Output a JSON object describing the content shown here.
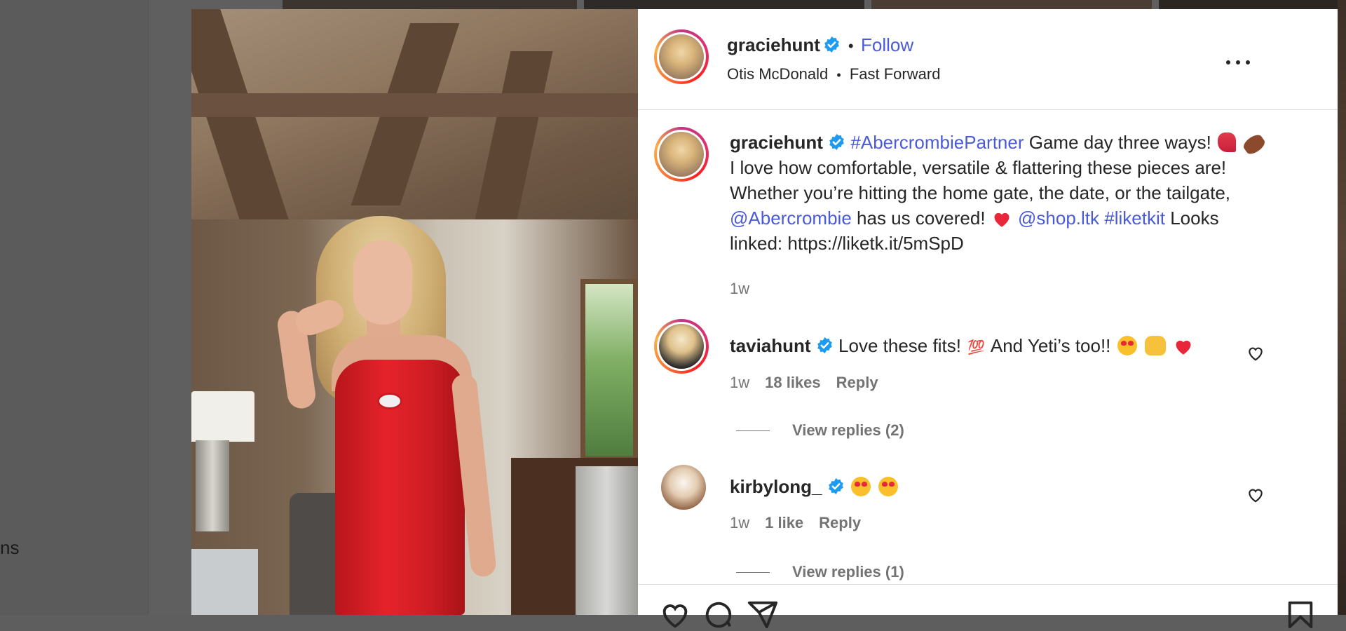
{
  "background": {
    "sidebar_fragment": "ns"
  },
  "post": {
    "author": {
      "username": "graciehunt",
      "follow_label": "Follow",
      "separator": "•"
    },
    "audio": {
      "artist": "Otis McDonald",
      "separator": "•",
      "track": "Fast Forward"
    },
    "caption": {
      "username": "graciehunt",
      "hashtag_partner": "#AbercrombiePartner",
      "line1_text": " Game day three ways! ",
      "line2": "I love how comfortable, versatile & flattering these pieces are!",
      "line3": "Whether you’re hitting the home gate, the date, or the tailgate,",
      "mention_brand": "@Abercrombie",
      "line4_text": " has us covered! ",
      "mention_shop": "@shop.ltk",
      "hashtag_liketkit": "#liketkit",
      "line4_tail": " Looks",
      "line5": "linked: https://liketk.it/5mSpD",
      "time": "1w"
    }
  },
  "comments": [
    {
      "username": "taviahunt",
      "text_a": "Love these fits! ",
      "text_b": " And Yeti’s too!! ",
      "hundred": "💯",
      "time": "1w",
      "likes": "18 likes",
      "reply_label": "Reply",
      "view_replies": "View replies (2)"
    },
    {
      "username": "kirbylong_",
      "time": "1w",
      "likes": "1 like",
      "reply_label": "Reply",
      "view_replies": "View replies (1)"
    }
  ],
  "icons": {
    "verified": "verified-badge-icon",
    "more": "more-options-icon",
    "like": "heart-icon",
    "comment": "comment-icon",
    "share": "share-icon",
    "save": "bookmark-icon"
  },
  "colors": {
    "link": "#4a5ad8",
    "verified": "#1d9bf0",
    "text": "#262626",
    "muted": "#737373"
  }
}
